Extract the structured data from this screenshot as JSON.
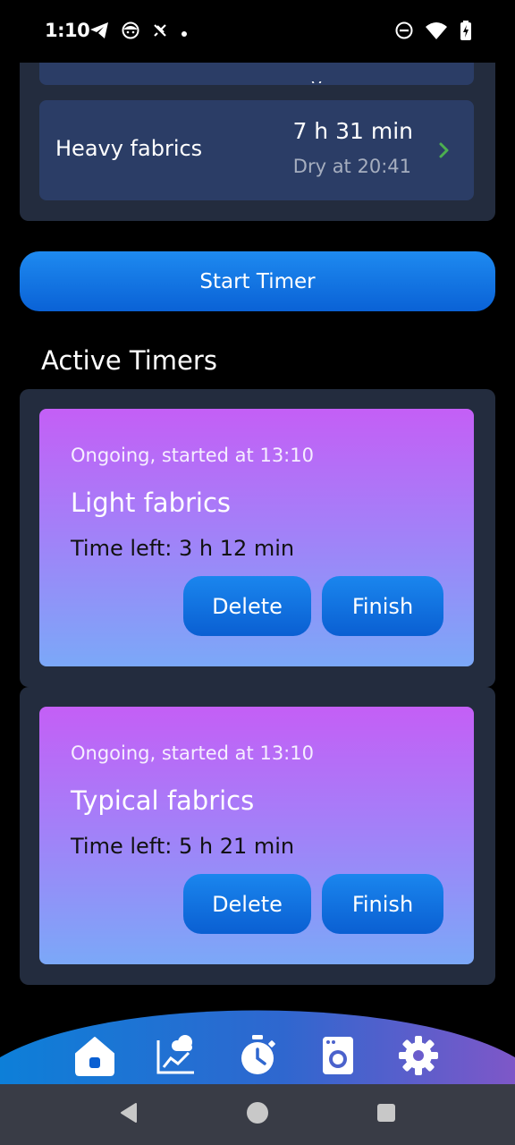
{
  "status_bar": {
    "time": "1:10",
    "left_icons": [
      "telegram-icon",
      "app-face-icon",
      "muted-notifications-icon",
      "dot-icon"
    ],
    "right_icons": [
      "do-not-disturb-icon",
      "wifi-icon",
      "battery-charging-icon"
    ]
  },
  "program": {
    "partial_row_text": "y",
    "rows": [
      {
        "name": "Heavy fabrics",
        "duration": "7 h 31 min",
        "dry_at": "Dry at 20:41"
      }
    ]
  },
  "start_timer_label": "Start Timer",
  "active_timers_title": "Active Timers",
  "timers": [
    {
      "status": "Ongoing, started at 13:10",
      "name": "Light fabrics",
      "time_left": "Time left: 3 h 12 min",
      "delete_label": "Delete",
      "finish_label": "Finish"
    },
    {
      "status": "Ongoing, started at 13:10",
      "name": "Typical fabrics",
      "time_left": "Time left: 5 h 21 min",
      "delete_label": "Delete",
      "finish_label": "Finish"
    }
  ],
  "bottom_nav": {
    "items": [
      "home-icon",
      "weather-chart-icon",
      "stopwatch-icon",
      "washing-machine-icon",
      "settings-icon"
    ],
    "active": "home-icon"
  },
  "colors": {
    "background": "#000000",
    "panel": "#232c3e",
    "row": "#2b3d66",
    "accent_blue": "#0a62d6",
    "card_gradient_top": "#c45ff6",
    "card_gradient_bottom": "#7ba8f8",
    "chevron": "#4caf50"
  }
}
